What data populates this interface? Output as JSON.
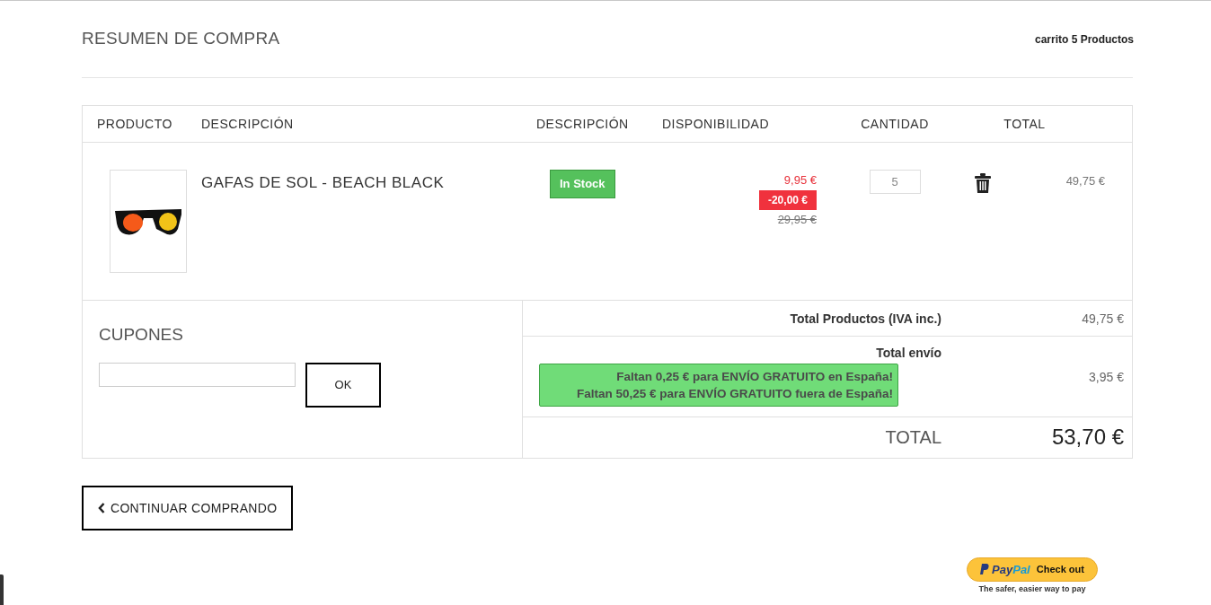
{
  "header": {
    "title": "RESUMEN DE COMPRA",
    "cart_summary": "carrito 5 Productos"
  },
  "table": {
    "columns": [
      "PRODUCTO",
      "DESCRIPCIÓN",
      "DESCRIPCIÓN",
      "DISPONIBILIDAD",
      "CANTIDAD",
      "TOTAL"
    ],
    "rows": [
      {
        "name": "GAFAS DE SOL - BEACH BLACK",
        "availability": "In Stock",
        "in_stock": true,
        "price": "9,95 €",
        "discount": "-20,00 €",
        "old_price": "29,95 €",
        "quantity": "5",
        "total": "49,75 €"
      }
    ]
  },
  "coupons": {
    "title": "CUPONES",
    "button": "OK"
  },
  "totals": {
    "products_label": "Total Productos (IVA inc.)",
    "products_value": "49,75 €",
    "shipping_label": "Total envío",
    "shipping_notices": [
      "Faltan 0,25 € para ENVÍO GRATUITO en España!",
      "Faltan 50,25 € para ENVÍO GRATUITO fuera de España!"
    ],
    "shipping_value": "3,95 €",
    "total_label": "TOTAL",
    "total_value": "53,70 €"
  },
  "continue_button": "CONTINUAR COMPRANDO",
  "paypal": {
    "brand_a": "Pay",
    "brand_b": "Pal",
    "action": "Check out",
    "tagline": "The safer, easier way to pay"
  }
}
